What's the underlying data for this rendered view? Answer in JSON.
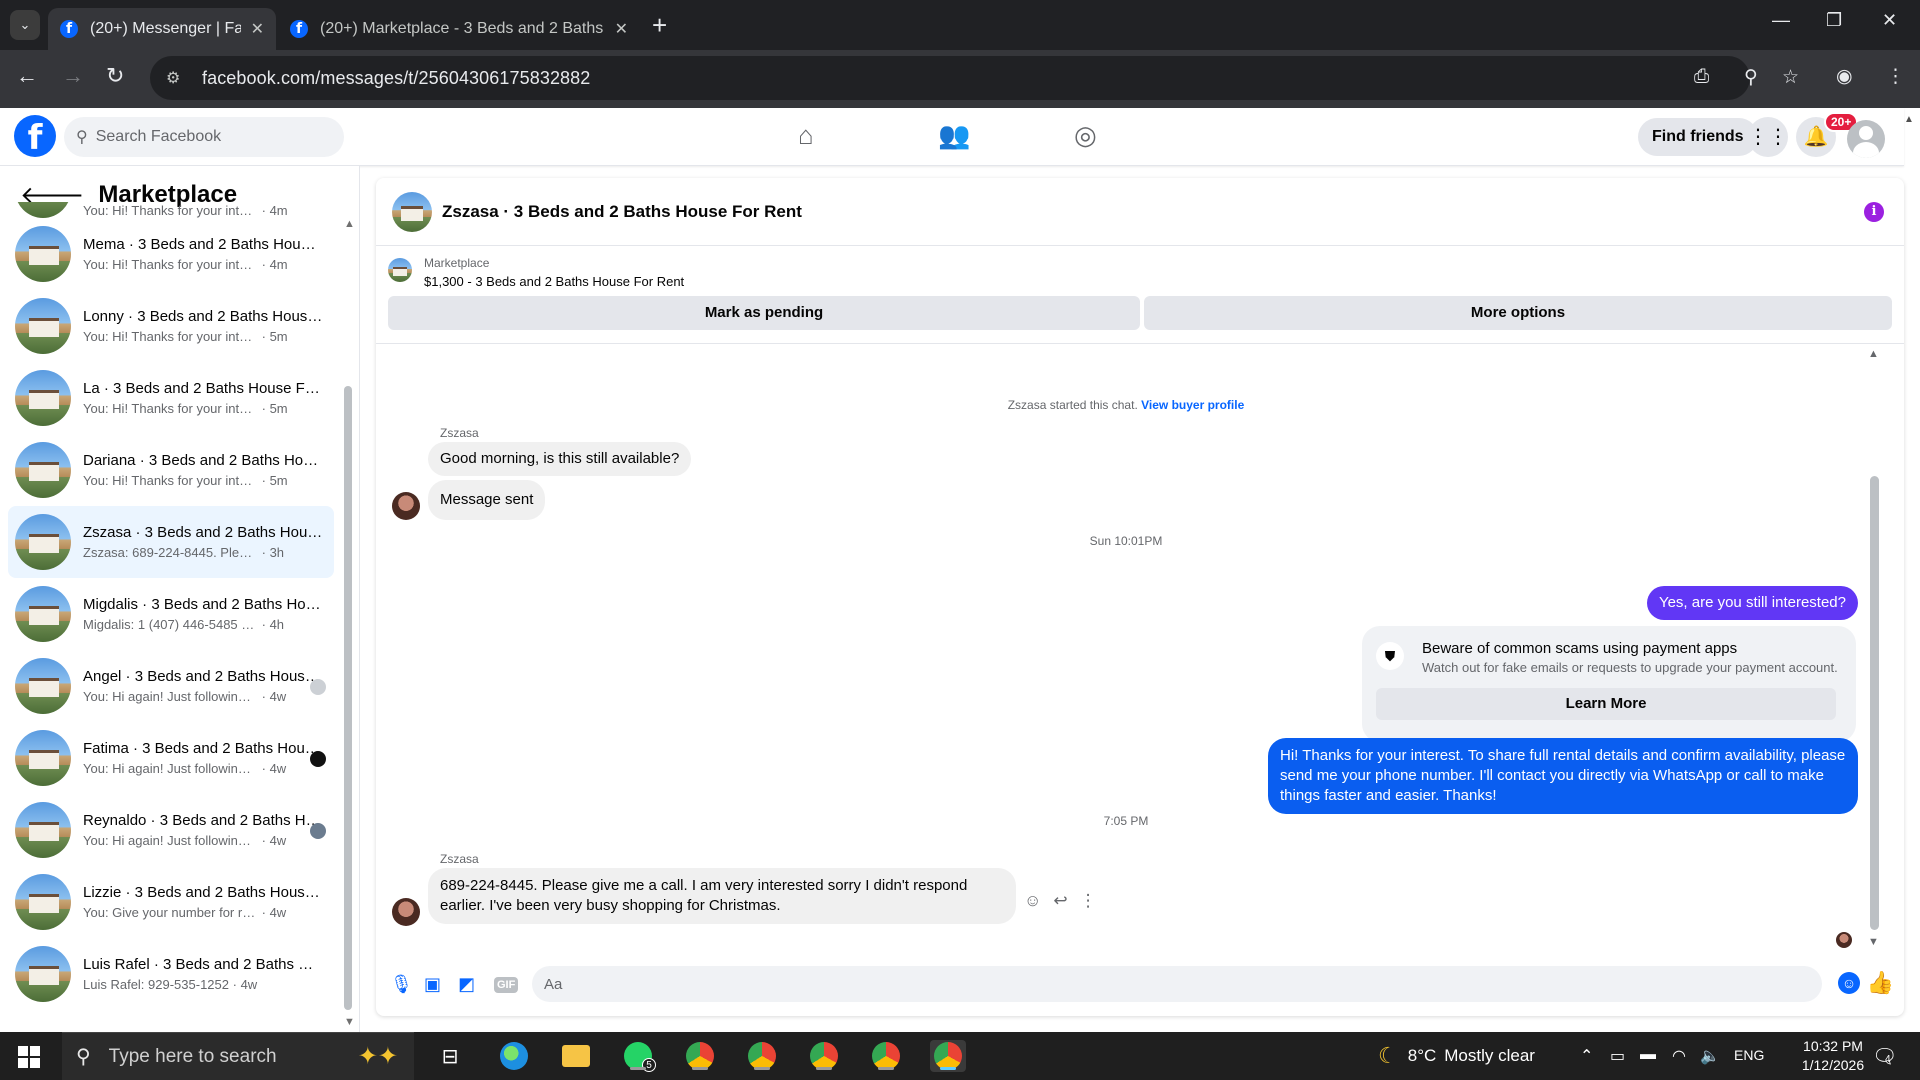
{
  "browser": {
    "tabs": [
      {
        "title": "(20+) Messenger | Facebook",
        "close": "✕"
      },
      {
        "title": "(20+) Marketplace - 3 Beds and 2 Baths",
        "close": "✕"
      }
    ],
    "new_tab": "+",
    "url": "facebook.com/messages/t/25604306175832882"
  },
  "fb_header": {
    "logo": "f",
    "search_placeholder": "Search Facebook",
    "find_friends_label": "Find friends",
    "notification_badge": "20+"
  },
  "sidebar": {
    "title": "Marketplace",
    "conversations": [
      {
        "name": "",
        "preview": "You: Hi! Thanks for your interest. T...",
        "time": "4m",
        "partial": true
      },
      {
        "name": "Mema · 3 Beds and 2 Baths House For Rent",
        "preview": "You: Hi! Thanks for your interest. T...",
        "time": "4m"
      },
      {
        "name": "Lonny · 3 Beds and 2 Baths House For Rent",
        "preview": "You: Hi! Thanks for your interest. T...",
        "time": "5m"
      },
      {
        "name": "La · 3 Beds and 2 Baths House For Rent",
        "preview": "You: Hi! Thanks for your interest. T...",
        "time": "5m"
      },
      {
        "name": "Dariana · 3 Beds and 2 Baths House For Rent",
        "preview": "You: Hi! Thanks for your interest. T...",
        "time": "5m"
      },
      {
        "name": "Zszasa · 3 Beds and 2 Baths House For Rent",
        "preview": "Zszasa: 689-224-8445. Please give ...",
        "time": "3h",
        "selected": true
      },
      {
        "name": "Migdalis · 3 Beds and 2 Baths House For Rent",
        "preview": "Migdalis: 1 (407) 446-5485 Pablo",
        "time": "4h"
      },
      {
        "name": "Angel · 3 Beds and 2 Baths House For Rent",
        "preview": "You: Hi again! Just following up...",
        "time": "4w",
        "read": "gray"
      },
      {
        "name": "Fatima · 3 Beds and 2 Baths House For Rent",
        "preview": "You: Hi again! Just following up...",
        "time": "4w",
        "read": "dark"
      },
      {
        "name": "Reynaldo · 3 Beds and 2 Baths House For Rent",
        "preview": "You: Hi again! Just following up...",
        "time": "4w",
        "read": "photo"
      },
      {
        "name": "Lizzie · 3 Beds and 2 Baths House For Rent",
        "preview": "You: Give your number for require...",
        "time": "4w"
      },
      {
        "name": "Luis Rafel · 3 Beds and 2 Baths House For Rent",
        "preview": "Luis Rafel: 929-535-1252",
        "time": "4w"
      }
    ]
  },
  "chat": {
    "title": "Zszasa · 3 Beds and 2 Baths House For Rent",
    "listing_label": "Marketplace",
    "listing_detail": "$1,300 - 3 Beds and 2 Baths House For Rent",
    "mark_pending": "Mark as pending",
    "more_options": "More options",
    "started_text": "Zszasa started this chat.",
    "view_buyer": "View buyer profile",
    "sender_name": "Zszasa",
    "msg_in_1": "Good morning, is this still available?",
    "msg_in_2": "Message sent",
    "timestamp_1": "Sun 10:01PM",
    "msg_out_1": "Yes, are you still interested?",
    "scam_title": "Beware of common scams using payment apps",
    "scam_sub": "Watch out for fake emails or requests to upgrade your payment account.",
    "learn_more": "Learn More",
    "msg_out_2": "Hi! Thanks for your interest. To share full rental details and confirm availability, please send me your phone number. I'll contact you directly via WhatsApp or call to make things faster and easier. Thanks!",
    "timestamp_2": "7:05 PM",
    "msg_in_3": "689-224-8445. Please give me a call. I am very interested sorry I didn't respond earlier. I've been very busy shopping for Christmas.",
    "composer_placeholder": "Aa"
  },
  "taskbar": {
    "search_placeholder": "Type here to search",
    "whatsapp_badge": "5",
    "temperature": "8°C",
    "weather": "Mostly clear",
    "language": "ENG",
    "time": "10:32 PM",
    "date": "1/12/2026",
    "notifications": "4"
  },
  "colors": {
    "fb_blue": "#0866ff",
    "outgoing_purple": "#6137f5",
    "outgoing_blue": "#0a5ef0",
    "selected_row": "#ebf5ff"
  }
}
